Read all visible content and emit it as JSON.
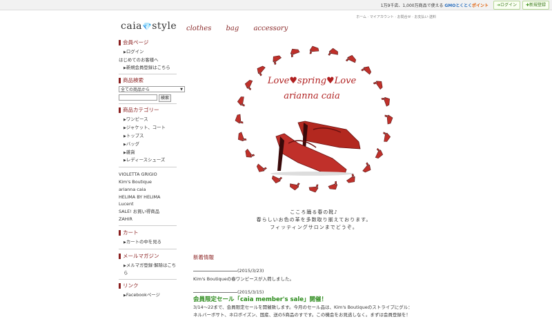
{
  "topbar": {
    "promo_prefix": "1万9千店、1,000万商品で使える",
    "promo_brand": "GMOとくとく",
    "promo_brand_suffix": "ポイント",
    "login_label": "ログイン",
    "register_label": "新規登録"
  },
  "subnav": {
    "items": [
      "ホーム",
      "マイアカウント",
      "お問合せ",
      "お支払い·送料"
    ]
  },
  "logo": {
    "left": "caia",
    "right": "style"
  },
  "catnav": {
    "items": [
      "clothes",
      "bag",
      "accessory"
    ]
  },
  "sidebar": {
    "member": {
      "heading": "会員ページ",
      "login": "ログイン",
      "first_time": "はじめてのお客様へ",
      "register": "新規会員登録はこちら"
    },
    "search": {
      "heading": "商品検索",
      "select_value": "全ての商品から",
      "button": "検索"
    },
    "category": {
      "heading": "商品カテゴリー",
      "items": [
        "ワンピース",
        "ジャケット、コート",
        "トップス",
        "バッグ",
        "雑貨",
        "レディースシューズ"
      ]
    },
    "brands": [
      "VIOLETTA GRIGIO",
      "Kim's Boutique",
      "arianna caia",
      "HELIMA BY HELIMA",
      "Lucent",
      "SALE! お買い得商品",
      "ZAHIR"
    ],
    "cart": {
      "heading": "カート",
      "view": "カートの中を見る"
    },
    "mail": {
      "heading": "メールマガジン",
      "subscribe": "メルマガ登録·解除はこちら"
    },
    "link": {
      "heading": "リンク",
      "item": "Facebookページ"
    }
  },
  "banner": {
    "line1": "Love♥spring♥Love",
    "line2": "arianna caia",
    "caption": [
      "こころ踊る春の靴♪",
      "春らしいお色の革を多数取り揃えております。",
      "フィッティングサロンまでどうぞ。"
    ]
  },
  "news": {
    "heading": "新着情報",
    "entries": [
      {
        "date": "(2015/3/23)",
        "text": "Kim's Boutiqueの春ワンピースが入荷しました。"
      },
      {
        "date": "(2015/3/15)",
        "title": "会員限定セール「caia member's sale」開催！",
        "body": "3/14～22まで、会員限定セールを開催致します。今月のセール品は、Kim's Boutiqueのストライプにグル：",
        "body2": "ネルバーボサト、ネロボイズン、国産、送の5商品のすです。この機会をお見逃しなく。まずは会員登録を！"
      }
    ]
  },
  "colors": {
    "accent": "#8a2020",
    "sale": "#2a8a1a",
    "shoe": "#c0302a"
  }
}
